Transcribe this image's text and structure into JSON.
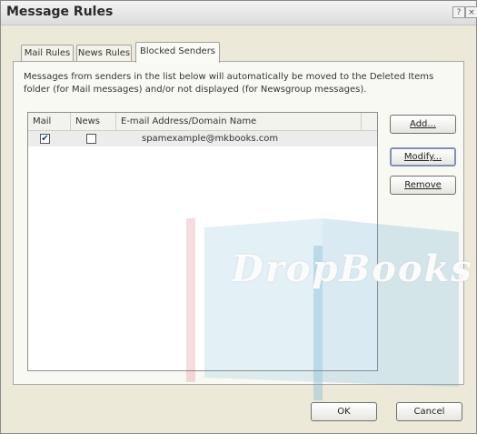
{
  "window": {
    "title": "Message Rules"
  },
  "titlebar": {
    "help_label": "?",
    "close_label": "×"
  },
  "tabs": [
    {
      "label": "Mail Rules",
      "active": false
    },
    {
      "label": "News Rules",
      "active": false
    },
    {
      "label": "Blocked Senders",
      "active": true
    }
  ],
  "description": "Messages from senders in the list below will automatically be moved to the Deleted Items folder (for Mail messages) and/or not displayed (for Newsgroup messages).",
  "list": {
    "columns": [
      "Mail",
      "News",
      "E-mail Address/Domain Name"
    ],
    "rows": [
      {
        "mail": true,
        "news": false,
        "address": "spamexample@mkbooks.com"
      }
    ]
  },
  "side_buttons": {
    "add": "Add...",
    "modify": "Modify...",
    "remove": "Remove"
  },
  "footer": {
    "ok": "OK",
    "cancel": "Cancel"
  },
  "watermark": {
    "text": "DropBooks"
  }
}
